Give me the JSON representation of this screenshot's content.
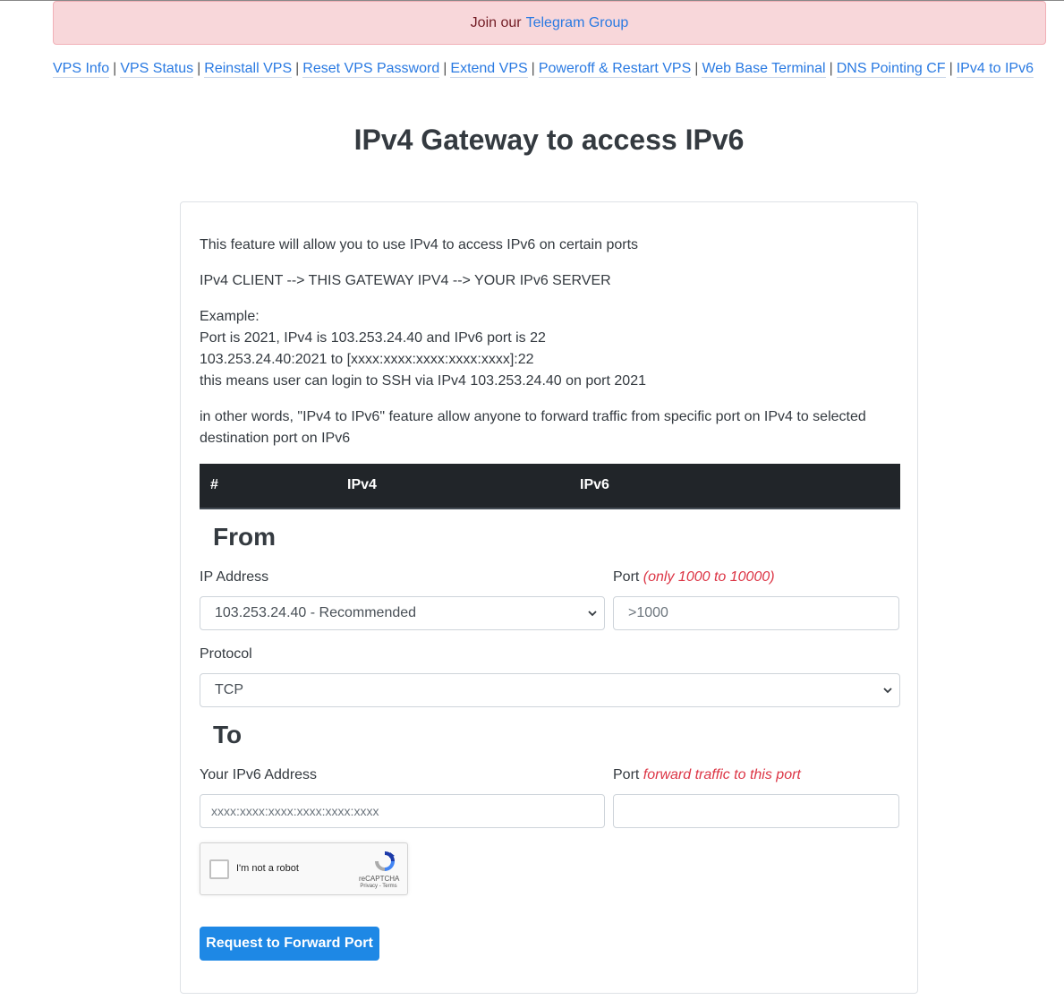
{
  "alert": {
    "text": "Join our",
    "link": "Telegram Group"
  },
  "nav": {
    "items": [
      "VPS Info",
      "VPS Status",
      "Reinstall VPS",
      "Reset VPS Password",
      "Extend VPS",
      "Poweroff & Restart VPS",
      "Web Base Terminal",
      "DNS Pointing CF",
      "IPv4 to IPv6"
    ],
    "separator": "|"
  },
  "page": {
    "title": "IPv4 Gateway to access IPv6"
  },
  "intro": {
    "line1": "This feature will allow you to use IPv4 to access IPv6 on certain ports",
    "line2": "IPv4 CLIENT --> THIS GATEWAY IPV4 --> YOUR IPv6 SERVER",
    "example_heading": "Example:",
    "example1": "Port is 2021, IPv4 is 103.253.24.40 and IPv6 port is 22",
    "example2": "103.253.24.40:2021 to [xxxx:xxxx:xxxx:xxxx:xxxx]:22",
    "example3": "this means user can login to SSH via IPv4 103.253.24.40 on port 2021",
    "summary": "in other words, \"IPv4 to IPv6\" feature allow anyone to forward traffic from specific port on IPv4 to selected destination port on IPv6"
  },
  "table": {
    "headers": [
      "#",
      "IPv4",
      "IPv6"
    ]
  },
  "from": {
    "title": "From",
    "ip_label": "IP Address",
    "ip_value": "103.253.24.40 - Recommended",
    "port_label": "Port",
    "port_hint": "(only 1000 to 10000)",
    "port_placeholder": ">1000",
    "protocol_label": "Protocol",
    "protocol_value": "TCP"
  },
  "to": {
    "title": "To",
    "ipv6_label": "Your IPv6 Address",
    "ipv6_placeholder": "xxxx:xxxx:xxxx:xxxx:xxxx:xxxx",
    "port_label": "Port",
    "port_hint": "forward traffic to this port",
    "port_value": ""
  },
  "captcha": {
    "label": "I'm not a robot",
    "brand": "reCAPTCHA",
    "links": "Privacy - Terms"
  },
  "submit": {
    "label": "Request to Forward Port"
  },
  "colors": {
    "alert_bg": "#f8d7da",
    "link": "#2a7ae2",
    "button": "#1e88e5",
    "hint": "#dc3545",
    "table_header": "#212529"
  }
}
